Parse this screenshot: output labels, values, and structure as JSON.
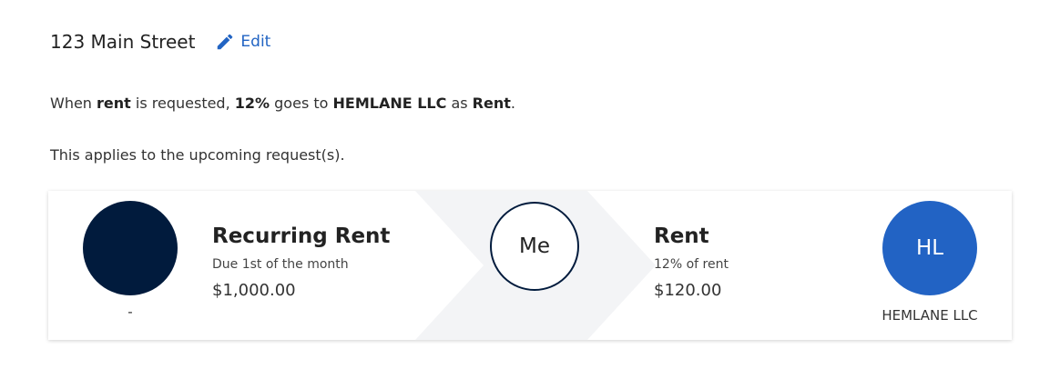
{
  "header": {
    "address": "123 Main Street",
    "edit_label": "Edit",
    "edit_icon": "pencil-icon"
  },
  "rule_sentence": {
    "part1": "When ",
    "bill_type": "rent",
    "part2": " is requested, ",
    "percent": "12%",
    "part3": " goes to ",
    "payee": "HEMLANE LLC",
    "part4": " as ",
    "category": "Rent",
    "part5": "."
  },
  "applies_text": "This applies to the upcoming request(s).",
  "flow_card": {
    "source": {
      "avatar_text": "",
      "caption": "-",
      "title": "Recurring Rent",
      "subtitle": "Due 1st of the month",
      "amount": "$1,000.00"
    },
    "middle": {
      "avatar_text": "Me"
    },
    "destination": {
      "title": "Rent",
      "subtitle": "12% of rent",
      "amount": "$120.00",
      "avatar_text": "HL",
      "caption": "HEMLANE LLC"
    }
  },
  "colors": {
    "link": "#2264c3",
    "navy_avatar": "#011b3d",
    "blue_avatar": "#2263c4",
    "arrow_band": "#f3f4f6"
  }
}
